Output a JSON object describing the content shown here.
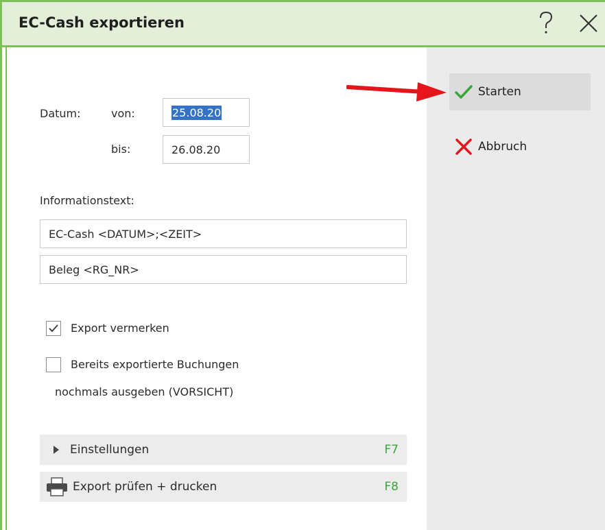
{
  "window": {
    "title": "EC-Cash exportieren",
    "help_icon": "question-icon",
    "close_icon": "close-icon"
  },
  "dates": {
    "datum_label": "Datum:",
    "von_label": "von:",
    "von_value": "25.08.20",
    "bis_label": "bis:",
    "bis_value": "26.08.20"
  },
  "info": {
    "label": "Informationstext:",
    "line1": "EC-Cash <DATUM>;<ZEIT>",
    "line2": "Beleg <RG_NR>"
  },
  "options": [
    {
      "label": "Export vermerken",
      "checked": true
    },
    {
      "label_line1": "Bereits exportierte Buchungen",
      "label_line2": "nochmals ausgeben (VORSICHT)",
      "checked": false
    }
  ],
  "bars": {
    "settings_label": "Einstellungen",
    "settings_key": "F7",
    "print_label": "Export prüfen + drucken",
    "print_key": "F8"
  },
  "actions": {
    "start_label": "Starten",
    "start_icon": "checkmark-icon",
    "cancel_label": "Abbruch",
    "cancel_icon": "x-icon"
  },
  "colors": {
    "frame": "#7fbf5a",
    "titlebar": "#e3efd9",
    "accent_key": "#3aa639",
    "arrow": "#e4161b",
    "selection": "#3372c4"
  }
}
